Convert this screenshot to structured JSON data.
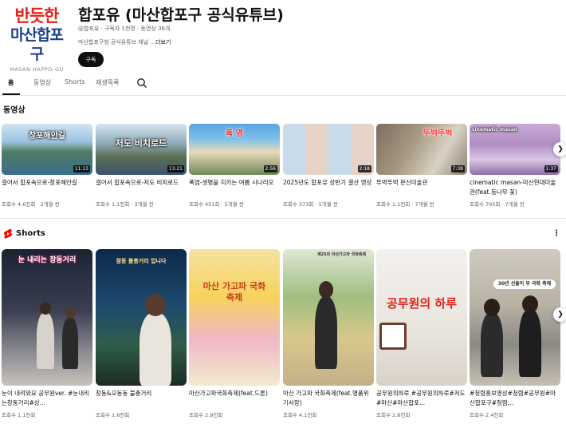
{
  "channel": {
    "logo_line1": "반듯한",
    "logo_line2": "마산합포구",
    "logo_line3": "MASAN HAPPO-GU",
    "name": "합포유 (마산합포구 공식유튜브)",
    "meta": "@합포유 · 구독자 1천명 · 동영상 36개",
    "description": "마산합포구청 공식유튜브 채널 ...",
    "more_label": "더보기",
    "subscribe_label": "구독"
  },
  "tabs": [
    {
      "label": "홈"
    },
    {
      "label": "동영상"
    },
    {
      "label": "Shorts"
    },
    {
      "label": "재생목록"
    }
  ],
  "videos_section": {
    "title": "동영상",
    "items": [
      {
        "thumb_text": "창포해안길",
        "duration": "11:13",
        "title": "걸어서 합포속으로-창포해안길",
        "meta": "조회수 4.6천회 · 2개월 전"
      },
      {
        "thumb_text": "저도 비치로드",
        "duration": "13:21",
        "title": "걸어서 합포속으로-저도 비치로드",
        "meta": "조회수 1.1천회 · 3개월 전"
      },
      {
        "thumb_text": "폭 염",
        "duration": "2:56",
        "title": "폭염-생명을 지키는 여름 시나리오",
        "meta": "조회수 451회 · 5개월 전"
      },
      {
        "thumb_text": "",
        "duration": "2:18",
        "title": "2025년도 합포유 상반기 결산 영상",
        "meta": "조회수 373회 · 5개월 전"
      },
      {
        "thumb_text": "뚜벅뚜벅",
        "duration": "7:38",
        "title": "뚜벅뚜벅 문신미술관",
        "meta": "조회수 1.1천회 · 7개월 전"
      },
      {
        "thumb_text": "cinematic masan",
        "duration": "1:37",
        "title": "cinematic masan-마산현대미술관(feat.등나무 꽃)",
        "meta": "조회수 795회 · 7개월 전"
      }
    ]
  },
  "shorts_section": {
    "title": "Shorts",
    "items": [
      {
        "thumb_text": "눈 내리는 창동거리",
        "title": "눈이 내려와요 공무원ver. #눈내리는창동거리#상...",
        "meta": "조회수 1.1천회"
      },
      {
        "thumb_text": "참동 불총거리 입니다",
        "title": "창동&오동동 불총거리",
        "meta": "조회수 1.6천회"
      },
      {
        "thumb_text": "마산 가고파 국화축제",
        "title": "마산가고파국화축제(feat.드론)",
        "meta": "조회수 2.9천회"
      },
      {
        "thumb_text": "제25회 마산가고파 국화축제",
        "title": "마산 가고파 국화축제(feat.명품위기사장)",
        "meta": "조회수 4.1천회"
      },
      {
        "thumb_text": "공무원의 하루",
        "title": "공무원의하루 #공무원의하루#저도 #마산#마산합포...",
        "meta": "조회수 2.8천회"
      },
      {
        "thumb_text": "30년 선돌이 부 국화 축제",
        "title": "#청렴홍보영상#청렴#공무원#마산합포구#청렴...",
        "meta": "조회수 2.4천회"
      }
    ]
  },
  "icons": {
    "search": "search-icon",
    "next": "chevron-right-icon",
    "shorts": "shorts-icon",
    "more": "more-vert-icon"
  }
}
